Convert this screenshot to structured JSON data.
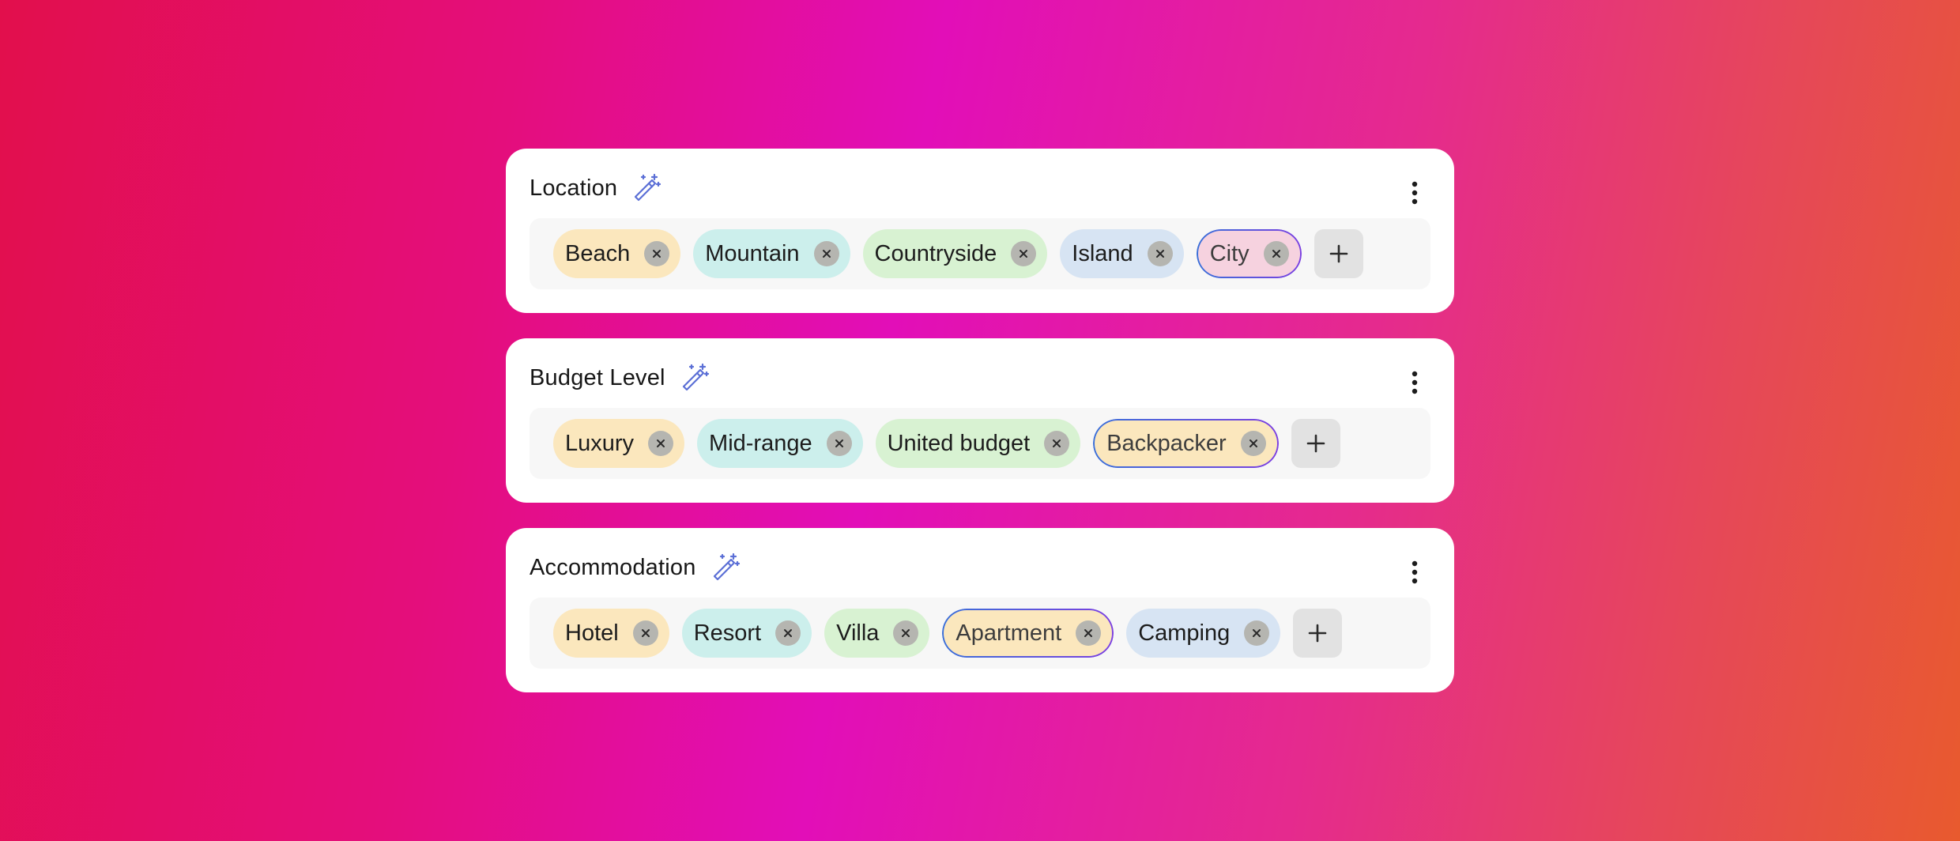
{
  "sections": [
    {
      "title": "Location",
      "tags": [
        {
          "label": "Beach",
          "color": "#fbe7bd"
        },
        {
          "label": "Mountain",
          "color": "#ccefec"
        },
        {
          "label": "Countryside",
          "color": "#d8f2d2"
        },
        {
          "label": "Island",
          "color": "#d7e4f3"
        },
        {
          "label": "City",
          "color": "#f6d2df",
          "selected": true
        }
      ]
    },
    {
      "title": "Budget Level",
      "tags": [
        {
          "label": "Luxury",
          "color": "#fbe7bd"
        },
        {
          "label": "Mid-range",
          "color": "#ccefec"
        },
        {
          "label": "United budget",
          "color": "#d8f2d2"
        },
        {
          "label": "Backpacker",
          "color": "#fbe7bd",
          "selected": true
        }
      ]
    },
    {
      "title": "Accommodation",
      "tags": [
        {
          "label": "Hotel",
          "color": "#fbe7bd"
        },
        {
          "label": "Resort",
          "color": "#ccefec"
        },
        {
          "label": "Villa",
          "color": "#d8f2d2"
        },
        {
          "label": "Apartment",
          "color": "#fbe7bd",
          "selected": true
        },
        {
          "label": "Camping",
          "color": "#d7e4f3"
        }
      ]
    }
  ],
  "icons": {
    "title_icon": "magic-wand-icon",
    "menu_icon": "more-vertical-icon",
    "remove_icon": "close-icon",
    "add_icon": "plus-icon"
  },
  "colors": {
    "selected_border_start": "#3a6fd8",
    "selected_border_end": "#7b3fe0",
    "remove_button": "#b5b5b0",
    "add_button": "#e2e2e2"
  }
}
